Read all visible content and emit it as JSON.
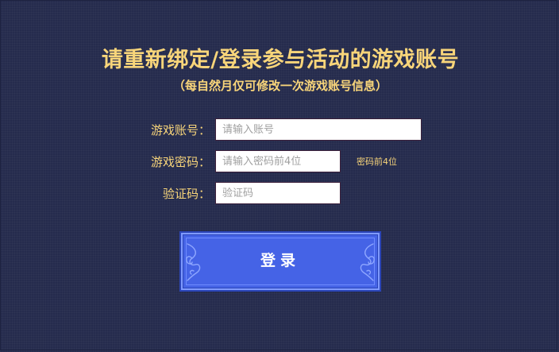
{
  "header": {
    "title": "请重新绑定/登录参与活动的游戏账号",
    "subtitle": "（每自然月仅可修改一次游戏账号信息）"
  },
  "form": {
    "account": {
      "label": "游戏账号：",
      "value": "",
      "placeholder": "请输入账号"
    },
    "password": {
      "label": "游戏密码：",
      "value": "",
      "placeholder": "请输入密码前4位",
      "hint": "密码前4位"
    },
    "captcha": {
      "label": "验证码：",
      "value": "",
      "placeholder": "验证码"
    }
  },
  "login_button": {
    "label": "登录"
  },
  "colors": {
    "background": "#252b4d",
    "accent_text": "#f8d57a",
    "button": "#4563e6"
  },
  "icons": {
    "button_ornament": "cloud-ornament-icon"
  }
}
